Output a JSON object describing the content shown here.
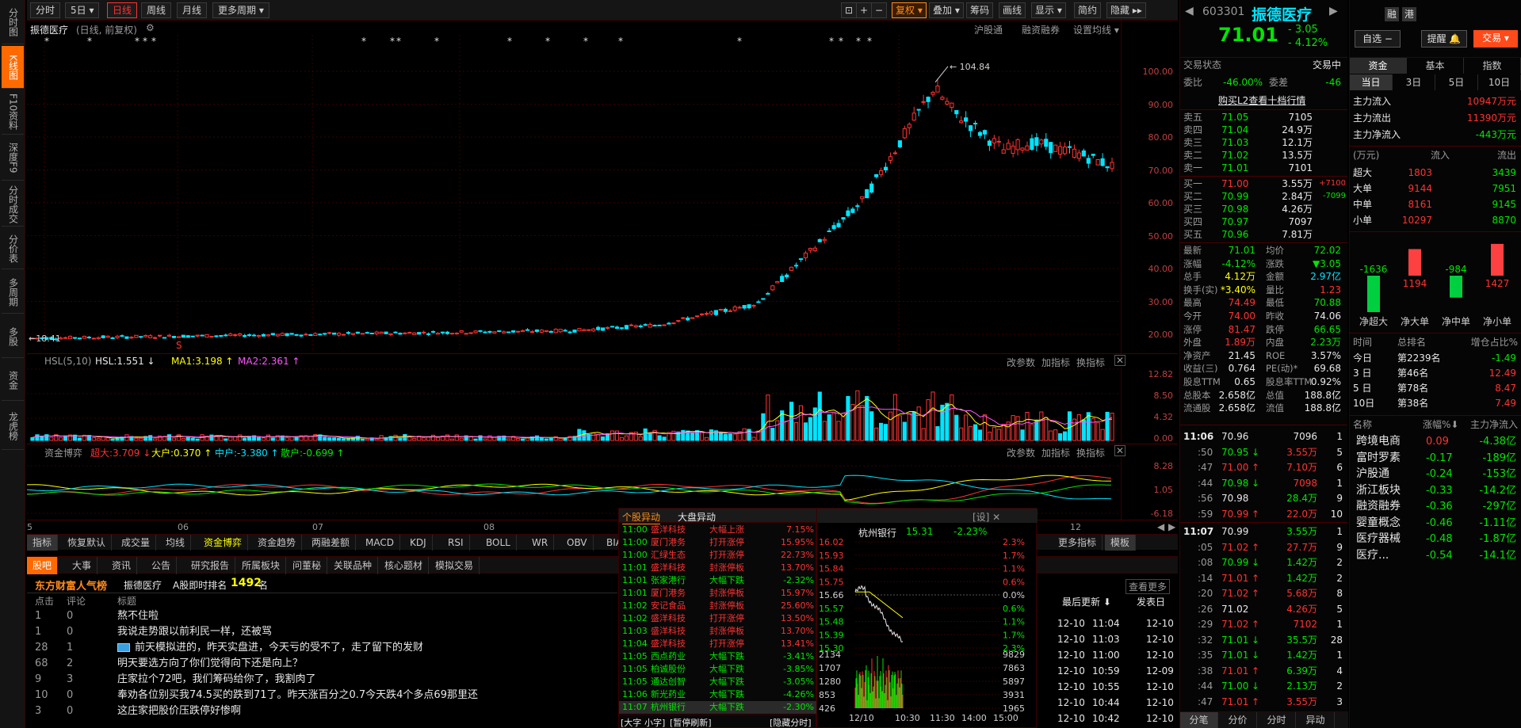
{
  "left_tabs": [
    {
      "label": "分时图",
      "active": false
    },
    {
      "label": "K线图",
      "active": true
    },
    {
      "label": "F10资料",
      "active": false
    },
    {
      "label": "深度F9",
      "active": false
    },
    {
      "label": "分时成交",
      "active": false
    },
    {
      "label": "分价表",
      "active": false
    },
    {
      "label": "多周期",
      "active": false
    },
    {
      "label": "多股",
      "active": false
    },
    {
      "label": "资金",
      "active": false
    },
    {
      "label": "龙虎榜",
      "active": false
    }
  ],
  "toolbar": {
    "periods": [
      "分时",
      "5日 ▾",
      "日线",
      "周线",
      "月线",
      "更多周期 ▾"
    ],
    "active_period": "日线",
    "right_buttons": [
      "⊡",
      "+",
      "−",
      "复权 ▾",
      "叠加 ▾",
      "筹码",
      "画线",
      "显示 ▾",
      "简约",
      "隐藏 ▸▸"
    ]
  },
  "chart_head": {
    "name": "振德医疗",
    "mode": "(日线, 前复权)",
    "right_links": [
      "沪股通",
      "融资融券",
      "设置均线 ▾"
    ]
  },
  "main_chart": {
    "high_label": "104.84",
    "low_label": "18.41",
    "axis": [
      "100.00",
      "90.00",
      "80.00",
      "70.00",
      "60.00",
      "50.00",
      "40.00",
      "30.00",
      "20.00"
    ],
    "x_labels": [
      "5",
      "06",
      "07",
      "08",
      "12"
    ]
  },
  "hsl_panel": {
    "title": "HSL(5,10)",
    "hsl": "HSL:1.551 ↓",
    "ma1": "MA1:3.198 ↑",
    "ma2": "MA2:2.361 ↑",
    "links": [
      "改参数",
      "加指标",
      "换指标"
    ],
    "axis": [
      "12.82",
      "8.50",
      "4.32",
      "0.00"
    ]
  },
  "fund_panel": {
    "title": "资金博弈",
    "big": "超大:3.709 ↓",
    "large": "大户:0.370 ↑",
    "mid": "中户:-3.380 ↑",
    "small": "散户:-0.699 ↑",
    "links": [
      "改参数",
      "加指标",
      "换指标"
    ],
    "axis": [
      "8.28",
      "1.05",
      "-6.18"
    ]
  },
  "indicator_tabs": [
    "指标",
    "恢复默认",
    "成交量",
    "均线",
    "资金博弈",
    "资金趋势",
    "两融差额",
    "MACD",
    "KDJ",
    "RSI",
    "BOLL",
    "WR",
    "OBV",
    "BIAS",
    "ENE"
  ],
  "indicator_right": [
    "更多指标",
    "模板"
  ],
  "news_tabs": [
    "股吧",
    "大事",
    "资讯",
    "公告",
    "研究报告",
    "所属板块",
    "问董秘",
    "关联品种",
    "核心题材",
    "模拟交易"
  ],
  "forum": {
    "brand": "东方财富人气榜",
    "stock": "振德医疗",
    "rank_label": "A股即时排名",
    "rank": "1492",
    "rank_unit": "名",
    "more": "查看更多",
    "cols": [
      "点击",
      "评论",
      "标题"
    ],
    "posts": [
      {
        "clicks": "1",
        "comments": "0",
        "title": "熬不住啦"
      },
      {
        "clicks": "1",
        "comments": "0",
        "title": "我说走势跟以前利民一样，还被骂"
      },
      {
        "clicks": "28",
        "comments": "1",
        "title": "前天模拟进的，昨天实盘进，今天亏的受不了，走了留下的发财"
      },
      {
        "clicks": "68",
        "comments": "2",
        "title": "明天要选方向了你们觉得向下还是向上？"
      },
      {
        "clicks": "9",
        "comments": "3",
        "title": "庄家拉个72吧，我们筹码给你了，我割肉了"
      },
      {
        "clicks": "10",
        "comments": "0",
        "title": "奉劝各位别买我74.5买的跌到71了。昨天涨百分之0.7今天跌4个多点69那里还"
      },
      {
        "clicks": "3",
        "comments": "0",
        "title": "这庄家把股价压跌停好惨啊"
      }
    ]
  },
  "abnormal": {
    "tabs": [
      "个股异动",
      "大盘异动"
    ],
    "close": "[设] ✕",
    "rows": [
      {
        "t": "11:00",
        "name": "盛洋科技",
        "type": "大幅上涨",
        "val": "7.15%",
        "up": true
      },
      {
        "t": "11:00",
        "name": "厦门港务",
        "type": "打开涨停",
        "val": "15.95%",
        "up": true
      },
      {
        "t": "11:00",
        "name": "汇绿生态",
        "type": "打开涨停",
        "val": "22.73%",
        "up": true
      },
      {
        "t": "11:01",
        "name": "盛洋科技",
        "type": "封涨停板",
        "val": "13.70%",
        "up": true
      },
      {
        "t": "11:01",
        "name": "张家港行",
        "type": "大幅下跌",
        "val": "-2.32%",
        "up": false
      },
      {
        "t": "11:01",
        "name": "厦门港务",
        "type": "封涨停板",
        "val": "15.97%",
        "up": true
      },
      {
        "t": "11:02",
        "name": "安记食品",
        "type": "封涨停板",
        "val": "25.60%",
        "up": true
      },
      {
        "t": "11:02",
        "name": "盛洋科技",
        "type": "打开涨停",
        "val": "13.50%",
        "up": true
      },
      {
        "t": "11:03",
        "name": "盛洋科技",
        "type": "封涨停板",
        "val": "13.70%",
        "up": true
      },
      {
        "t": "11:04",
        "name": "盛洋科技",
        "type": "打开涨停",
        "val": "13.41%",
        "up": true
      },
      {
        "t": "11:05",
        "name": "西点药业",
        "type": "大幅下跌",
        "val": "-3.41%",
        "up": false
      },
      {
        "t": "11:05",
        "name": "柏诚股份",
        "type": "大幅下跌",
        "val": "-3.85%",
        "up": false
      },
      {
        "t": "11:05",
        "name": "通达创智",
        "type": "大幅下跌",
        "val": "-3.05%",
        "up": false
      },
      {
        "t": "11:06",
        "name": "新光药业",
        "type": "大幅下跌",
        "val": "-4.26%",
        "up": false
      },
      {
        "t": "11:07",
        "name": "杭州银行",
        "type": "大幅下跌",
        "val": "-2.30%",
        "up": false
      }
    ],
    "footer": [
      "[大字",
      "小字]",
      "[暂停刷新]",
      "[隐藏分时]"
    ]
  },
  "mini_chart": {
    "name": "杭州银行",
    "price": "15.31",
    "pct": "-2.23%",
    "left_axis": [
      "16.02",
      "15.93",
      "15.84",
      "15.75",
      "15.66",
      "15.57",
      "15.48",
      "15.39",
      "15.30"
    ],
    "right_axis": [
      "2.3%",
      "1.7%",
      "1.1%",
      "0.6%",
      "0.0%",
      "0.6%",
      "1.1%",
      "1.7%",
      "2.3%"
    ],
    "vol_left": [
      "2134",
      "1707",
      "1280",
      "853",
      "426"
    ],
    "vol_right": [
      "9829",
      "7863",
      "5897",
      "3931",
      "1965"
    ],
    "x_labels": [
      "12/10",
      "10:30",
      "11:30",
      "14:00",
      "15:00"
    ]
  },
  "recent": {
    "head": [
      "最后更新 ⬇",
      "发表日"
    ],
    "rows": [
      {
        "a": "12-10",
        "b": "11:04",
        "c": "12-10"
      },
      {
        "a": "12-10",
        "b": "11:03",
        "c": "12-10"
      },
      {
        "a": "12-10",
        "b": "11:00",
        "c": "12-10"
      },
      {
        "a": "12-10",
        "b": "10:59",
        "c": "12-09"
      },
      {
        "a": "12-10",
        "b": "10:55",
        "c": "12-10"
      },
      {
        "a": "12-10",
        "b": "10:44",
        "c": "12-10"
      },
      {
        "a": "12-10",
        "b": "10:42",
        "c": "12-10"
      }
    ]
  },
  "quote": {
    "code": "603301",
    "name": "振德医疗",
    "badges": [
      "融",
      "港"
    ],
    "price": "71.01",
    "change": "- 3.05",
    "pct": "- 4.12%",
    "buttons": [
      "自选 −",
      "提醒 🔔",
      "交易 ▾"
    ],
    "state_label": "交易状态",
    "state": "交易中",
    "wb_label": "委比",
    "wb": "-46.00%",
    "wc_label": "委差",
    "wc": "-46",
    "l2": "购买L2查看十档行情",
    "sells": [
      {
        "label": "卖五",
        "price": "71.05",
        "vol": "7105",
        "chg": ""
      },
      {
        "label": "卖四",
        "price": "71.04",
        "vol": "24.9万",
        "chg": ""
      },
      {
        "label": "卖三",
        "price": "71.03",
        "vol": "12.1万",
        "chg": ""
      },
      {
        "label": "卖二",
        "price": "71.02",
        "vol": "13.5万",
        "chg": ""
      },
      {
        "label": "卖一",
        "price": "71.01",
        "vol": "7101",
        "chg": ""
      }
    ],
    "buys": [
      {
        "label": "买一",
        "price": "71.00",
        "vol": "3.55万",
        "chg": "+7100"
      },
      {
        "label": "买二",
        "price": "70.99",
        "vol": "2.84万",
        "chg": "-7099"
      },
      {
        "label": "买三",
        "price": "70.98",
        "vol": "4.26万",
        "chg": ""
      },
      {
        "label": "买四",
        "price": "70.97",
        "vol": "7097",
        "chg": ""
      },
      {
        "label": "买五",
        "price": "70.96",
        "vol": "7.81万",
        "chg": ""
      }
    ],
    "stats": [
      {
        "l1": "最新",
        "v1": "71.01",
        "c1": "green",
        "l2": "均价",
        "v2": "72.02",
        "c2": "green"
      },
      {
        "l1": "涨幅",
        "v1": "-4.12%",
        "c1": "green",
        "l2": "涨跌",
        "v2": "▼3.05",
        "c2": "green"
      },
      {
        "l1": "总手",
        "v1": "4.12万",
        "c1": "yellow",
        "l2": "金额",
        "v2": "2.97亿",
        "c2": "cyan"
      },
      {
        "l1": "换手(实)",
        "v1": "*3.40%",
        "c1": "yellow",
        "l2": "量比",
        "v2": "1.23",
        "c2": "red"
      },
      {
        "l1": "最高",
        "v1": "74.49",
        "c1": "red",
        "l2": "最低",
        "v2": "70.88",
        "c2": "green"
      },
      {
        "l1": "今开",
        "v1": "74.00",
        "c1": "red",
        "l2": "昨收",
        "v2": "74.06",
        "c2": "white"
      },
      {
        "l1": "涨停",
        "v1": "81.47",
        "c1": "red",
        "l2": "跌停",
        "v2": "66.65",
        "c2": "green"
      },
      {
        "l1": "外盘",
        "v1": "1.89万",
        "c1": "red",
        "l2": "内盘",
        "v2": "2.23万",
        "c2": "green"
      },
      {
        "l1": "净资产",
        "v1": "21.45",
        "c1": "white",
        "l2": "ROE",
        "v2": "3.57%",
        "c2": "white"
      },
      {
        "l1": "收益(三)",
        "v1": "0.764",
        "c1": "white",
        "l2": "PE(动)*",
        "v2": "69.68",
        "c2": "white"
      },
      {
        "l1": "股息TTM",
        "v1": "0.65",
        "c1": "white",
        "l2": "股息率TTM",
        "v2": "0.92%",
        "c2": "white"
      },
      {
        "l1": "总股本",
        "v1": "2.658亿",
        "c1": "white",
        "l2": "总值",
        "v2": "188.8亿",
        "c2": "white"
      },
      {
        "l1": "流通股",
        "v1": "2.658亿",
        "c1": "white",
        "l2": "流值",
        "v2": "188.8亿",
        "c2": "white"
      }
    ],
    "ticks1": {
      "time": "11:06",
      "rows": [
        {
          "t": "11:06",
          "p": "70.96",
          "arrow": "",
          "v": "7096",
          "n": "1",
          "pc": "white",
          "vc": "white"
        },
        {
          "t": ":50",
          "p": "70.95",
          "arrow": "↓",
          "v": "3.55万",
          "n": "5",
          "pc": "green",
          "vc": "red"
        },
        {
          "t": ":47",
          "p": "71.00",
          "arrow": "↑",
          "v": "7.10万",
          "n": "6",
          "pc": "red",
          "vc": "red"
        },
        {
          "t": ":44",
          "p": "70.98",
          "arrow": "↓",
          "v": "7098",
          "n": "1",
          "pc": "green",
          "vc": "red"
        },
        {
          "t": ":56",
          "p": "70.98",
          "arrow": "",
          "v": "28.4万",
          "n": "9",
          "pc": "white",
          "vc": "green"
        },
        {
          "t": ":59",
          "p": "70.99",
          "arrow": "↑",
          "v": "22.0万",
          "n": "10",
          "pc": "red",
          "vc": "red"
        }
      ]
    },
    "ticks2": {
      "time": "11:07",
      "rows": [
        {
          "t": "11:07",
          "p": "70.99",
          "arrow": "",
          "v": "3.55万",
          "n": "1",
          "pc": "white",
          "vc": "green"
        },
        {
          "t": ":05",
          "p": "71.02",
          "arrow": "↑",
          "v": "27.7万",
          "n": "9",
          "pc": "red",
          "vc": "red"
        },
        {
          "t": ":08",
          "p": "70.99",
          "arrow": "↓",
          "v": "1.42万",
          "n": "2",
          "pc": "green",
          "vc": "green"
        },
        {
          "t": ":14",
          "p": "71.01",
          "arrow": "↑",
          "v": "1.42万",
          "n": "2",
          "pc": "red",
          "vc": "green"
        },
        {
          "t": ":20",
          "p": "71.02",
          "arrow": "↑",
          "v": "5.68万",
          "n": "8",
          "pc": "red",
          "vc": "red"
        },
        {
          "t": ":26",
          "p": "71.02",
          "arrow": "",
          "v": "4.26万",
          "n": "5",
          "pc": "white",
          "vc": "red"
        },
        {
          "t": ":29",
          "p": "71.02",
          "arrow": "↑",
          "v": "7102",
          "n": "1",
          "pc": "red",
          "vc": "red"
        },
        {
          "t": ":32",
          "p": "71.01",
          "arrow": "↓",
          "v": "35.5万",
          "n": "28",
          "pc": "green",
          "vc": "green"
        },
        {
          "t": ":35",
          "p": "71.01",
          "arrow": "↓",
          "v": "1.42万",
          "n": "1",
          "pc": "green",
          "vc": "green"
        },
        {
          "t": ":38",
          "p": "71.01",
          "arrow": "↑",
          "v": "6.39万",
          "n": "4",
          "pc": "red",
          "vc": "green"
        },
        {
          "t": ":44",
          "p": "71.00",
          "arrow": "↓",
          "v": "2.13万",
          "n": "2",
          "pc": "green",
          "vc": "green"
        },
        {
          "t": ":47",
          "p": "71.01",
          "arrow": "↑",
          "v": "3.55万",
          "n": "3",
          "pc": "red",
          "vc": "red"
        }
      ]
    },
    "bottom_tabs": [
      "分笔",
      "分价",
      "分时",
      "异动"
    ]
  },
  "flow": {
    "tabs": [
      "资金",
      "基本",
      "指数"
    ],
    "periods": [
      "当日",
      "3日",
      "5日",
      "10日"
    ],
    "main_in_label": "主力流入",
    "main_in": "10947万元",
    "main_out_label": "主力流出",
    "main_out": "11390万元",
    "main_net_label": "主力净流入",
    "main_net": "-443万元",
    "table_head": [
      "(万元)",
      "流入",
      "流出"
    ],
    "table": [
      {
        "k": "超大",
        "in": "1803",
        "out": "3439"
      },
      {
        "k": "大单",
        "in": "9144",
        "out": "7951"
      },
      {
        "k": "中单",
        "in": "8161",
        "out": "9145"
      },
      {
        "k": "小单",
        "in": "10297",
        "out": "8870"
      }
    ],
    "bar_values": [
      "-1636",
      "1194",
      "-984",
      "1427"
    ],
    "bar_labels": [
      "净超大",
      "净大单",
      "净中单",
      "净小单"
    ],
    "rank_head": [
      "时间",
      "总排名",
      "增仓占比%"
    ],
    "ranks": [
      {
        "t": "今日",
        "r": "第2239名",
        "p": "-1.49"
      },
      {
        "t": "3 日",
        "r": "第46名",
        "p": "12.49"
      },
      {
        "t": "5 日",
        "r": "第78名",
        "p": "8.47"
      },
      {
        "t": "10日",
        "r": "第38名",
        "p": "7.49"
      }
    ],
    "sector_head": [
      "名称",
      "涨幅%⬇",
      "主力净流入"
    ],
    "sectors": [
      {
        "n": "跨境电商",
        "p": "0.09",
        "v": "-4.38亿"
      },
      {
        "n": "富时罗素",
        "p": "-0.17",
        "v": "-189亿"
      },
      {
        "n": "沪股通",
        "p": "-0.24",
        "v": "-153亿"
      },
      {
        "n": "浙江板块",
        "p": "-0.33",
        "v": "-14.2亿"
      },
      {
        "n": "融资融券",
        "p": "-0.36",
        "v": "-297亿"
      },
      {
        "n": "婴童概念",
        "p": "-0.46",
        "v": "-1.11亿"
      },
      {
        "n": "医疗器械",
        "p": "-0.48",
        "v": "-1.87亿"
      },
      {
        "n": "医疗...",
        "p": "-0.54",
        "v": "-14.1亿"
      }
    ]
  }
}
